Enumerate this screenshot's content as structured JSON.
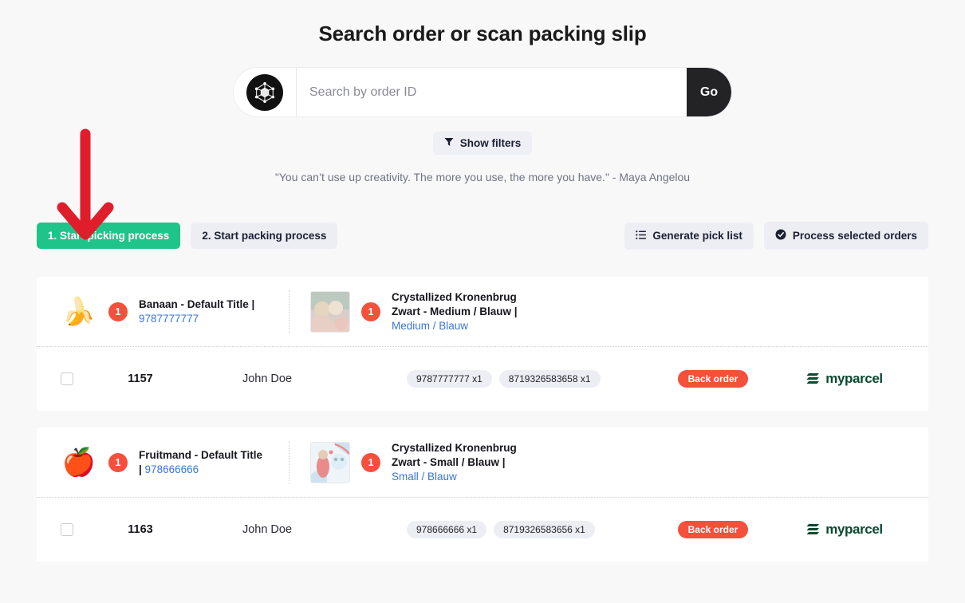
{
  "header": {
    "title": "Search order or scan packing slip"
  },
  "search": {
    "logo_icon": "polyhedron-logo-icon",
    "placeholder": "Search by order ID",
    "value": "",
    "go_label": "Go"
  },
  "filters": {
    "icon": "funnel-icon",
    "label": "Show filters"
  },
  "quote": {
    "text": "\"You can’t use up creativity. The more you use, the more you have.\" - Maya Angelou"
  },
  "actions": {
    "left": [
      {
        "label": "1. Start picking process",
        "primary": true,
        "icon": null
      },
      {
        "label": "2. Start packing process",
        "primary": false,
        "icon": null
      }
    ],
    "right": [
      {
        "label": "Generate pick list",
        "primary": false,
        "icon": "list-icon"
      },
      {
        "label": "Process selected orders",
        "primary": false,
        "icon": "check-circle-icon"
      }
    ]
  },
  "annotation": {
    "arrow_color": "#e01e2b",
    "arrow_direction": "down"
  },
  "colors": {
    "page_bg": "#f8f8f9",
    "card_bg": "#ffffff",
    "accent_green": "#1fc48a",
    "badge_red": "#f4503c",
    "link_blue": "#3b74d6",
    "carrier_green": "#0b4a31"
  },
  "orders": [
    {
      "products": [
        {
          "thumb_kind": "emoji",
          "emoji": "🍌",
          "qty": "1",
          "title": "Banaan - Default Title |",
          "sku": "9787777777",
          "variant": ""
        },
        {
          "thumb_kind": "image",
          "emoji": "",
          "qty": "1",
          "title": "Crystallized Kronenbrug Zwart - Medium / Blauw |",
          "sku": "",
          "variant": "Medium / Blauw"
        }
      ],
      "checkbox_checked": false,
      "order_id": "1157",
      "customer": "John Doe",
      "sku_pills": [
        "9787777777 x1",
        "8719326583658 x1"
      ],
      "status": "Back order",
      "carrier": "myparcel"
    },
    {
      "products": [
        {
          "thumb_kind": "emoji",
          "emoji": "🍎",
          "qty": "1",
          "title": "Fruitmand - Default Title |",
          "sku": "978666666",
          "variant": ""
        },
        {
          "thumb_kind": "image",
          "emoji": "",
          "qty": "1",
          "title": "Crystallized Kronenbrug Zwart - Small / Blauw |",
          "sku": "",
          "variant": "Small / Blauw"
        }
      ],
      "checkbox_checked": false,
      "order_id": "1163",
      "customer": "John Doe",
      "sku_pills": [
        "978666666 x1",
        "8719326583656 x1"
      ],
      "status": "Back order",
      "carrier": "myparcel"
    }
  ]
}
